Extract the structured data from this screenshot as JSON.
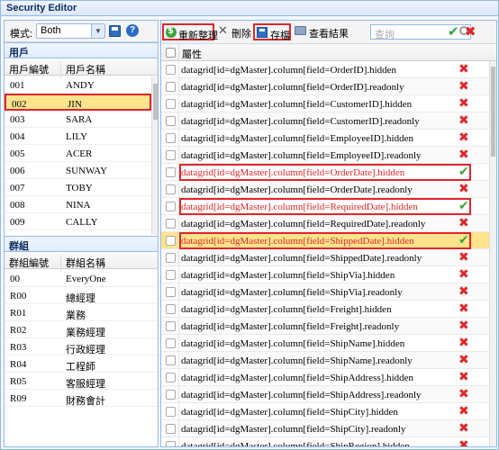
{
  "window": {
    "title": "Security Editor"
  },
  "mode": {
    "label": "模式:",
    "value": "Both"
  },
  "icons": {
    "save": "save-disk-icon",
    "help": "help-question-icon"
  },
  "users": {
    "section_title": "用戶",
    "columns": [
      "用戶編號",
      "用戶名稱"
    ],
    "rows": [
      [
        "001",
        "ANDY"
      ],
      [
        "002",
        "JIN"
      ],
      [
        "003",
        "SARA"
      ],
      [
        "004",
        "LILY"
      ],
      [
        "005",
        "ACER"
      ],
      [
        "006",
        "SUNWAY"
      ],
      [
        "007",
        "TOBY"
      ],
      [
        "008",
        "NINA"
      ],
      [
        "009",
        "CALLY"
      ]
    ]
  },
  "groups": {
    "section_title": "群組",
    "columns": [
      "群組編號",
      "群組名稱"
    ],
    "rows": [
      [
        "00",
        "EveryOne"
      ],
      [
        "R00",
        "總經理"
      ],
      [
        "R01",
        "業務"
      ],
      [
        "R02",
        "業務經理"
      ],
      [
        "R03",
        "行政經理"
      ],
      [
        "R04",
        "工程師"
      ],
      [
        "R05",
        "客服經理"
      ],
      [
        "R09",
        "財務會計"
      ]
    ]
  },
  "toolbar": {
    "refresh_label": "重新整理",
    "delete_label": "刪除",
    "save_label": "存檔",
    "view_label": "查看結果",
    "search_placeholder": "查詢"
  },
  "properties": {
    "column_header": "屬性",
    "rows": [
      {
        "name": "datagrid[id=dgMaster].column[field=OrderID].hidden",
        "allowed": false
      },
      {
        "name": "datagrid[id=dgMaster].column[field=OrderID].readonly",
        "allowed": false
      },
      {
        "name": "datagrid[id=dgMaster].column[field=CustomerID].hidden",
        "allowed": false
      },
      {
        "name": "datagrid[id=dgMaster].column[field=CustomerID].readonly",
        "allowed": false
      },
      {
        "name": "datagrid[id=dgMaster].column[field=EmployeeID].hidden",
        "allowed": false
      },
      {
        "name": "datagrid[id=dgMaster].column[field=EmployeeID].readonly",
        "allowed": false
      },
      {
        "name": "datagrid[id=dgMaster].column[field=OrderDate].hidden",
        "allowed": true
      },
      {
        "name": "datagrid[id=dgMaster].column[field=OrderDate].readonly",
        "allowed": false
      },
      {
        "name": "datagrid[id=dgMaster].column[field=RequiredDate].hidden",
        "allowed": true
      },
      {
        "name": "datagrid[id=dgMaster].column[field=RequiredDate].readonly",
        "allowed": false
      },
      {
        "name": "datagrid[id=dgMaster].column[field=ShippedDate].hidden",
        "allowed": true
      },
      {
        "name": "datagrid[id=dgMaster].column[field=ShippedDate].readonly",
        "allowed": false
      },
      {
        "name": "datagrid[id=dgMaster].column[field=ShipVia].hidden",
        "allowed": false
      },
      {
        "name": "datagrid[id=dgMaster].column[field=ShipVia].readonly",
        "allowed": false
      },
      {
        "name": "datagrid[id=dgMaster].column[field=Freight].hidden",
        "allowed": false
      },
      {
        "name": "datagrid[id=dgMaster].column[field=Freight].readonly",
        "allowed": false
      },
      {
        "name": "datagrid[id=dgMaster].column[field=ShipName].hidden",
        "allowed": false
      },
      {
        "name": "datagrid[id=dgMaster].column[field=ShipName].readonly",
        "allowed": false
      },
      {
        "name": "datagrid[id=dgMaster].column[field=ShipAddress].hidden",
        "allowed": false
      },
      {
        "name": "datagrid[id=dgMaster].column[field=ShipAddress].readonly",
        "allowed": false
      },
      {
        "name": "datagrid[id=dgMaster].column[field=ShipCity].hidden",
        "allowed": false
      },
      {
        "name": "datagrid[id=dgMaster].column[field=ShipCity].readonly",
        "allowed": false
      },
      {
        "name": "datagrid[id=dgMaster].column[field=ShipRegion].hidden",
        "allowed": false
      }
    ]
  },
  "colors": {
    "highlight_red": "#e0262a",
    "selected_row": "#ffe48d",
    "allowed_green": "#3aa33a"
  }
}
